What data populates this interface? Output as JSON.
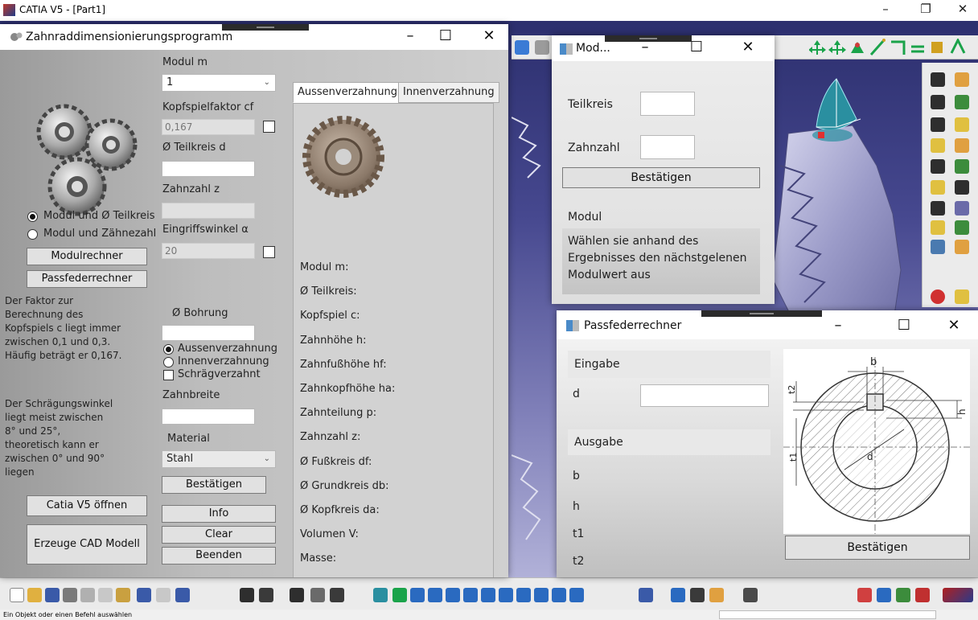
{
  "catia": {
    "title": "CATIA V5 - [Part1]",
    "status": "Ein Objekt oder einen Befehl auswählen",
    "ctrl_min": "–",
    "ctrl_max": "❐",
    "ctrl_close": "✕"
  },
  "main": {
    "title": "Zahnraddimensionierungsprogramm",
    "modul_label": "Modul m",
    "modul_value": "1",
    "kopfspiel_label": "Kopfspielfaktor cf",
    "kopfspiel_value": "0,167",
    "teilkreis_label": "Ø Teilkreis d",
    "zahnzahl_label": "Zahnzahl z",
    "eingriff_label": "Eingriffswinkel α",
    "eingriff_value": "20",
    "bohrung_label": "Ø Bohrung",
    "radio_aussen": "Aussenverzahnung",
    "radio_innen": "Innenverzahnung",
    "chk_schraeg": "Schrägverzahnt",
    "zahnbreite_label": "Zahnbreite",
    "material_label": "Material",
    "material_value": "Stahl",
    "btn_bestaetigen": "Bestätigen",
    "btn_info": "Info",
    "btn_clear": "Clear",
    "btn_beenden": "Beenden",
    "radio_modul_teilkreis": "Modul und Ø Teilkreis",
    "radio_modul_zaehnezahl": "Modul und Zähnezahl",
    "btn_modulrechner": "Modulrechner",
    "btn_passfeder": "Passfederrechner",
    "info_text1": "Der Faktor zur\nBerechnung des\nKopfspiels c liegt immer\nzwischen 0,1 und 0,3.\nHäufig beträgt er 0,167.",
    "info_text2": "Der Schrägungswinkel\nliegt meist zwischen\n8° und 25°,\ntheoretisch kann er\nzwischen 0° und 90°\nliegen",
    "btn_catia": "Catia V5 öffnen",
    "btn_cad": "Erzeuge CAD Modell",
    "tab_aussen": "Aussenverzahnung",
    "tab_innen": "Innenverzahnung",
    "outputs": [
      "Modul m:",
      "Ø Teilkreis:",
      "Kopfspiel c:",
      "Zahnhöhe h:",
      "Zahnfußhöhe hf:",
      "Zahnkopfhöhe ha:",
      "Zahnteilung p:",
      "Zahnzahl z:",
      "Ø Fußkreis df:",
      "Ø Grundkreis db:",
      "Ø Kopfkreis da:",
      "Volumen V:",
      "Masse:"
    ],
    "ctrl_min": "–",
    "ctrl_max": "☐",
    "ctrl_close": "✕"
  },
  "modul": {
    "title": "Mod...",
    "teilkreis_label": "Teilkreis",
    "zahnzahl_label": "Zahnzahl",
    "btn_bestaetigen": "Bestätigen",
    "modul_label": "Modul",
    "result_text": "Wählen sie anhand des\nErgebnisses den nächstgelenen\nModulwert aus",
    "ctrl_min": "–",
    "ctrl_max": "☐",
    "ctrl_close": "✕"
  },
  "passfeder": {
    "title": "Passfederrechner",
    "eingabe_label": "Eingabe",
    "d_label": "d",
    "ausgabe_label": "Ausgabe",
    "b_label": "b",
    "h_label": "h",
    "t1_label": "t1",
    "t2_label": "t2",
    "btn_bestaetigen": "Bestätigen",
    "dim_b": "b",
    "dim_h": "h",
    "dim_t1": "t1",
    "dim_t2": "t2",
    "dim_d": "d",
    "ctrl_min": "–",
    "ctrl_max": "☐",
    "ctrl_close": "✕"
  }
}
